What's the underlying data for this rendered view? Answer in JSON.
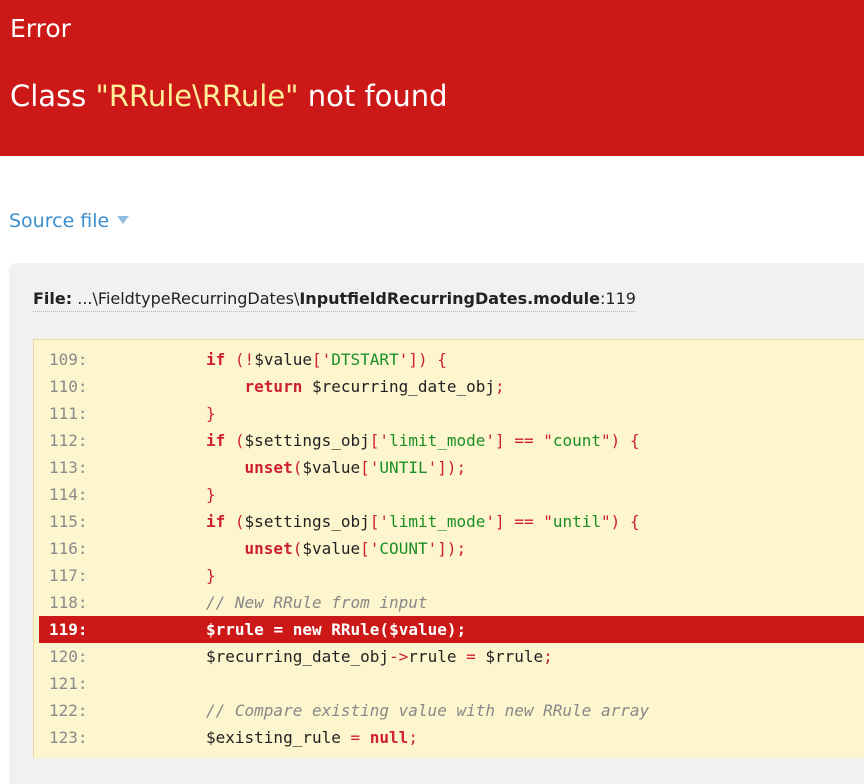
{
  "header": {
    "error_type": "Error",
    "message_prefix": "Class ",
    "message_class": "\"RRule\\RRule\"",
    "message_suffix": " not found"
  },
  "source_toggle": {
    "label": "Source file"
  },
  "file": {
    "label": "File:",
    "directory": "...\\FieldtypeRecurringDates\\",
    "filename": "InputfieldRecurringDates.module",
    "line_suffix": ":119"
  },
  "code": {
    "highlighted_line": 119,
    "lines": [
      {
        "num": "109:",
        "text": "if (!$value['DTSTART']) {"
      },
      {
        "num": "110:",
        "text": "    return $recurring_date_obj;"
      },
      {
        "num": "111:",
        "text": "}"
      },
      {
        "num": "112:",
        "text": "if ($settings_obj['limit_mode'] == \"count\") {"
      },
      {
        "num": "113:",
        "text": "    unset($value['UNTIL']);"
      },
      {
        "num": "114:",
        "text": "}"
      },
      {
        "num": "115:",
        "text": "if ($settings_obj['limit_mode'] == \"until\") {"
      },
      {
        "num": "116:",
        "text": "    unset($value['COUNT']);"
      },
      {
        "num": "117:",
        "text": "}"
      },
      {
        "num": "118:",
        "text": "// New RRule from input"
      },
      {
        "num": "119:",
        "text": "$rrule = new RRule($value);"
      },
      {
        "num": "120:",
        "text": "$recurring_date_obj->rrule = $rrule;"
      },
      {
        "num": "121:",
        "text": ""
      },
      {
        "num": "122:",
        "text": "// Compare existing value with new RRule array"
      },
      {
        "num": "123:",
        "text": "$existing_rule = null;"
      }
    ]
  },
  "colors": {
    "error_red": "#cd1818",
    "class_highlight": "#ffef9a",
    "link_blue": "#3b8fce",
    "code_background": "#fdf5ce",
    "panel_background": "#f2f1ef"
  }
}
